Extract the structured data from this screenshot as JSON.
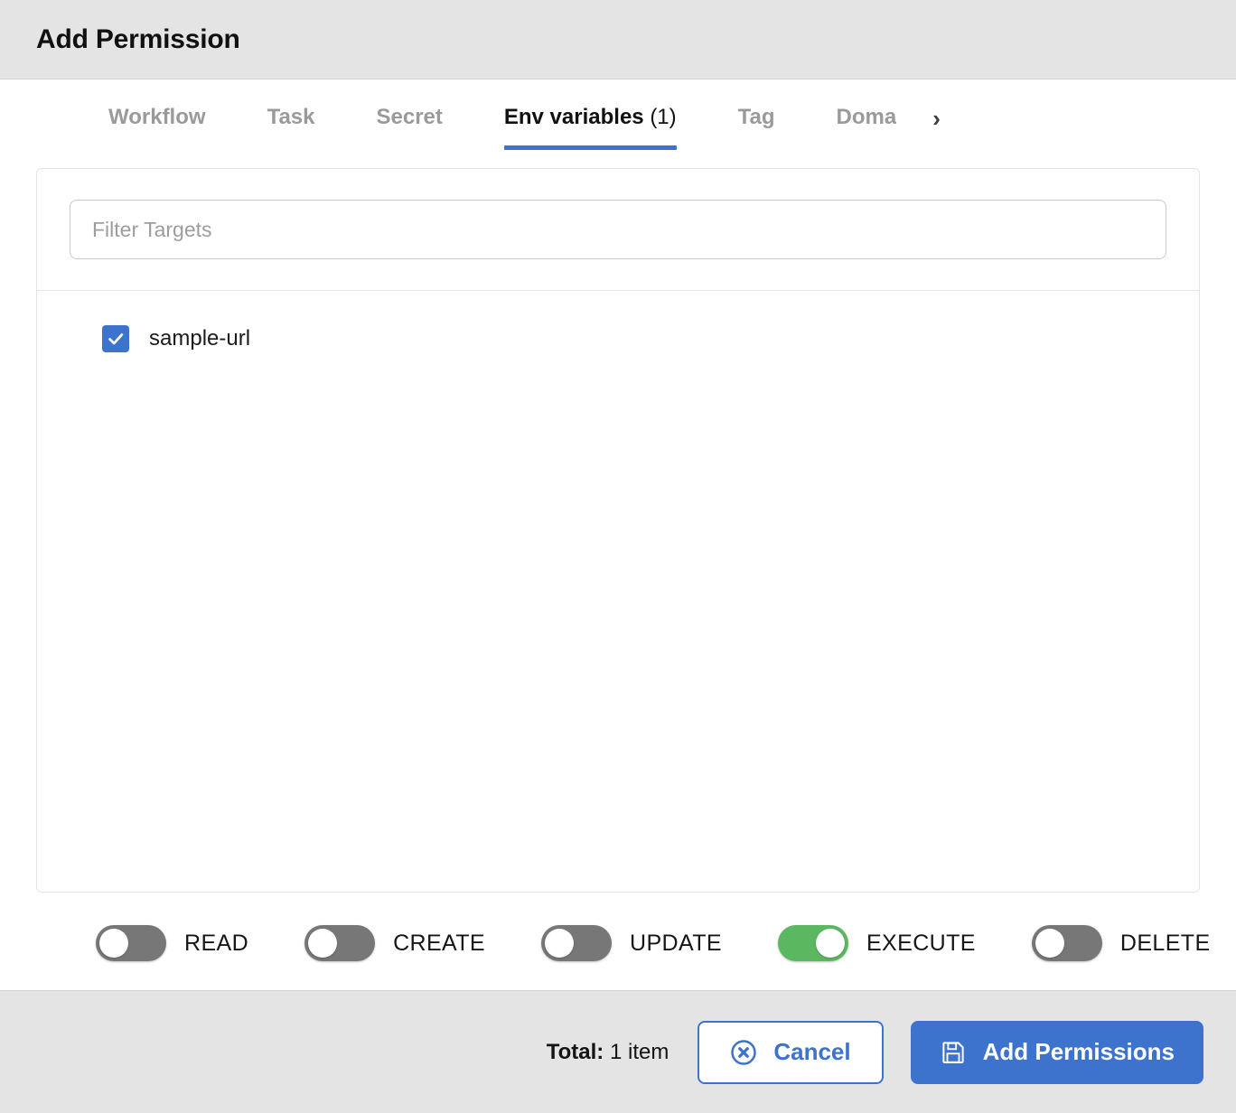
{
  "header": {
    "title": "Add Permission"
  },
  "tabs": {
    "items": [
      {
        "label": "Workflow",
        "active": false,
        "count": ""
      },
      {
        "label": "Task",
        "active": false,
        "count": ""
      },
      {
        "label": "Secret",
        "active": false,
        "count": ""
      },
      {
        "label": "Env variables",
        "active": true,
        "count": "(1)"
      },
      {
        "label": "Tag",
        "active": false,
        "count": ""
      },
      {
        "label": "Doma",
        "active": false,
        "count": ""
      }
    ],
    "next_icon": "chevron-right-icon",
    "next_glyph": "›"
  },
  "filter": {
    "placeholder": "Filter Targets",
    "value": ""
  },
  "targets": [
    {
      "label": "sample-url",
      "checked": true
    }
  ],
  "permissions": [
    {
      "label": "READ",
      "on": false
    },
    {
      "label": "CREATE",
      "on": false
    },
    {
      "label": "UPDATE",
      "on": false
    },
    {
      "label": "EXECUTE",
      "on": true
    },
    {
      "label": "DELETE",
      "on": false
    }
  ],
  "footer": {
    "total_key": "Total:",
    "total_value": " 1 item",
    "cancel_label": "Cancel",
    "cancel_icon": "circle-x-icon",
    "submit_label": "Add Permissions",
    "submit_icon": "save-floppy-icon"
  },
  "colors": {
    "accent_blue": "#3e73cd",
    "toggle_on_green": "#5cb860",
    "toggle_off_gray": "#777777",
    "chrome_gray": "#e4e4e4"
  }
}
